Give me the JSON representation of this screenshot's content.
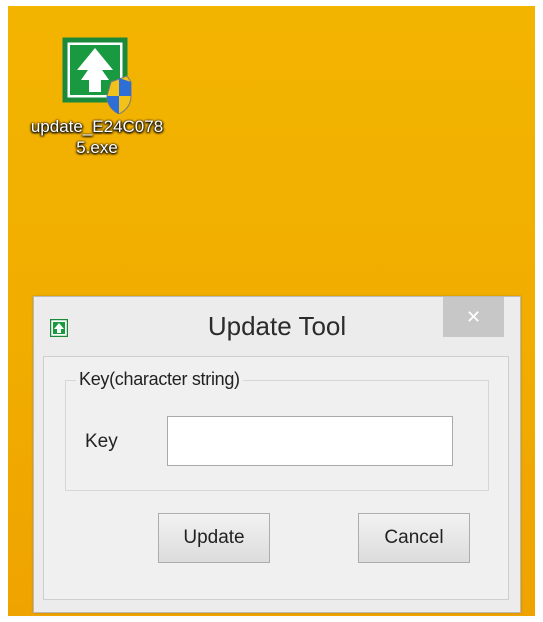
{
  "desktop": {
    "background_color": "#f1ad00",
    "icon": {
      "name": "update-exe-icon",
      "label": "update_E24C0785.exe"
    }
  },
  "dialog": {
    "title": "Update Tool",
    "close_glyph": "✕",
    "group": {
      "legend": "Key(character string)",
      "key_label": "Key",
      "key_value": ""
    },
    "buttons": {
      "update": "Update",
      "cancel": "Cancel"
    }
  },
  "colors": {
    "icon_green": "#1a8a3a",
    "shield_blue": "#2d6fd6",
    "shield_yellow": "#f2c21b",
    "close_button_bg": "#c7c7c7"
  }
}
